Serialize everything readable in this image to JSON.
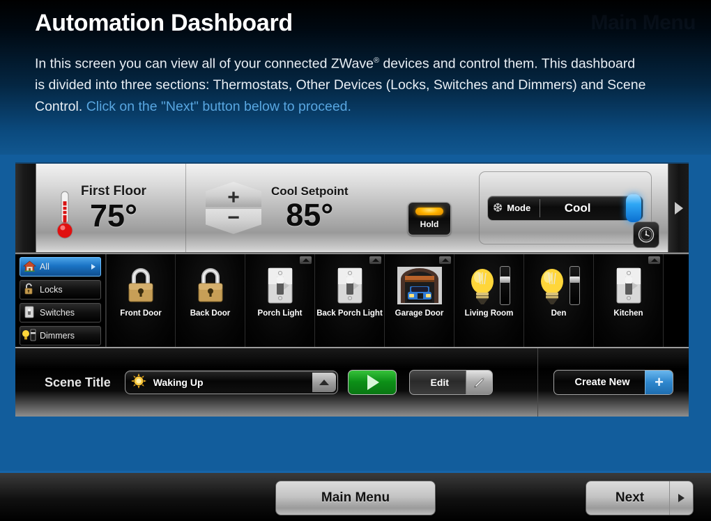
{
  "header": {
    "ghost_title": "Main Menu",
    "title": "Automation Dashboard",
    "intro_part1": "In this screen you can view all of your connected ZWave",
    "intro_sup": "®",
    "intro_part2": " devices and control them. This dashboard is divided into three sections: Thermostats, Other Devices (Locks, Switches and Dimmers) and Scene Control. ",
    "intro_hint": " Click on the \"Next\" button below to proceed."
  },
  "thermostat": {
    "left_scroll_icon": "scroll-left-tab",
    "right_scroll_icon": "scroll-right-arrow",
    "thermometer_icon": "thermometer-icon",
    "zone_name": "First Floor",
    "current_temp": "75°",
    "step_up_label": "+",
    "step_down_label": "−",
    "setpoint_label": "Cool Setpoint",
    "setpoint_value": "85°",
    "hold_label": "Hold",
    "mode_icon": "sun-snowflake-icon",
    "mode_label": "Mode",
    "mode_value": "Cool",
    "schedule_icon": "clock-icon"
  },
  "categories": [
    {
      "label": "All",
      "icon": "house-icon",
      "glyph": "🏠",
      "active": true
    },
    {
      "label": "Locks",
      "icon": "padlock-open-icon",
      "glyph": "🔓",
      "active": false
    },
    {
      "label": "Switches",
      "icon": "toggle-switch-icon",
      "glyph": "🎚",
      "active": false
    },
    {
      "label": "Dimmers",
      "icon": "bulb-slider-icon",
      "glyph": "💡",
      "active": false
    }
  ],
  "devices": [
    {
      "label": "Front Door",
      "icon": "padlock-icon",
      "type": "lock",
      "badge": false,
      "slider": false
    },
    {
      "label": "Back Door",
      "icon": "padlock-icon",
      "type": "lock",
      "badge": false,
      "slider": false
    },
    {
      "label": "Porch Light",
      "icon": "light-switch-icon",
      "type": "switch",
      "badge": true,
      "slider": false
    },
    {
      "label": "Back Porch Light",
      "icon": "light-switch-icon",
      "type": "switch",
      "badge": true,
      "slider": false
    },
    {
      "label": "Garage Door",
      "icon": "garage-door-icon",
      "type": "garage",
      "badge": true,
      "slider": false
    },
    {
      "label": "Living Room",
      "icon": "light-bulb-icon",
      "type": "dimmer",
      "badge": false,
      "slider": true
    },
    {
      "label": "Den",
      "icon": "light-bulb-icon",
      "type": "dimmer",
      "badge": false,
      "slider": true
    },
    {
      "label": "Kitchen",
      "icon": "light-switch-icon",
      "type": "switch",
      "badge": true,
      "slider": false
    }
  ],
  "scene": {
    "title": "Scene Title",
    "selected": "Waking Up",
    "scene_icon": "sun-icon",
    "dropdown_icon": "caret-up-icon",
    "play_icon": "play-icon",
    "edit_label": "Edit",
    "edit_icon": "pencil-icon",
    "create_label": "Create New",
    "create_icon": "plus-icon"
  },
  "footer": {
    "main_menu_label": "Main Menu",
    "next_label": "Next",
    "next_icon": "caret-right-icon"
  },
  "colors": {
    "background_blue": "#125d9c",
    "accent_blue": "#1664a8",
    "link_blue": "#58a6e0",
    "active_green": "#0c8f17",
    "hold_amber": "#ffb400"
  }
}
